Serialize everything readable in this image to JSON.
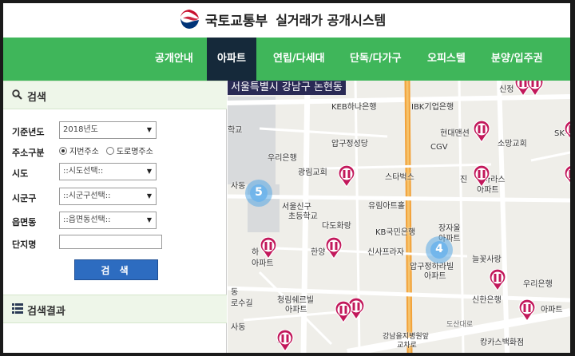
{
  "header": {
    "ministry": "국토교통부",
    "system": "실거래가 공개시스템"
  },
  "nav": {
    "items": [
      "공개안내",
      "아파트",
      "연립/다세대",
      "단독/다가구",
      "오피스텔",
      "분양/입주권"
    ],
    "active": "아파트"
  },
  "search_panel": {
    "title": "검색",
    "year_label": "기준년도",
    "year_value": "2018년도",
    "addr_type_label": "주소구분",
    "addr_options": [
      "지번주소",
      "도로명주소"
    ],
    "addr_selected": "지번주소",
    "sido_label": "시도",
    "sido_value": "::시도선택::",
    "sigungu_label": "시군구",
    "sigungu_value": "::시군구선택::",
    "dong_label": "읍면동",
    "dong_value": "::읍면동선택::",
    "complex_label": "단지명",
    "complex_value": "",
    "search_button": "검 색"
  },
  "results_panel": {
    "title": "검색결과"
  },
  "map": {
    "region": "서울특별시 강남구 논현동",
    "clusters": [
      "5",
      "4"
    ],
    "labels": {
      "l1": "KEB하나은행",
      "l2": "IBK기업은행",
      "l3": "신정",
      "l4": "현대맨션",
      "l5": "압구정성당",
      "l6": "소망교회",
      "l7": "SK주",
      "l8": "우리은행",
      "l9": "CGV",
      "l10": "광림교회",
      "l11": "스타벅스",
      "l12": "진",
      "l13": "마라스",
      "l14": "아파트",
      "l15": "서울신구",
      "l16": "초등학교",
      "l17": "유림아트홀",
      "l18": "다도화랑",
      "l19": "장자울",
      "l20": "아파트",
      "l21": "KB국민은행",
      "l22": "한양",
      "l23": "신사프라자",
      "l24": "압구정하라빌",
      "l25": "아파트",
      "l26": "늘꽃사랑",
      "l27": "우리은행",
      "l28": "청림쉐르빌",
      "l29": "아파트",
      "l30": "신한은행",
      "l31": "아파트",
      "l32": "도산대로",
      "l33": "태",
      "l34": "강남을지병원앞",
      "l35": "교차로",
      "l36": "캉카스백화점",
      "l37": "학교",
      "l38": "사동",
      "l39": "하",
      "l40": "아파트",
      "l41": "동",
      "l42": "로수길",
      "l43": "사동"
    }
  },
  "colors": {
    "nav_green": "#3fb65a",
    "nav_active": "#15293a",
    "button_blue": "#2d6cc0",
    "pin_magenta": "#c2185b"
  }
}
